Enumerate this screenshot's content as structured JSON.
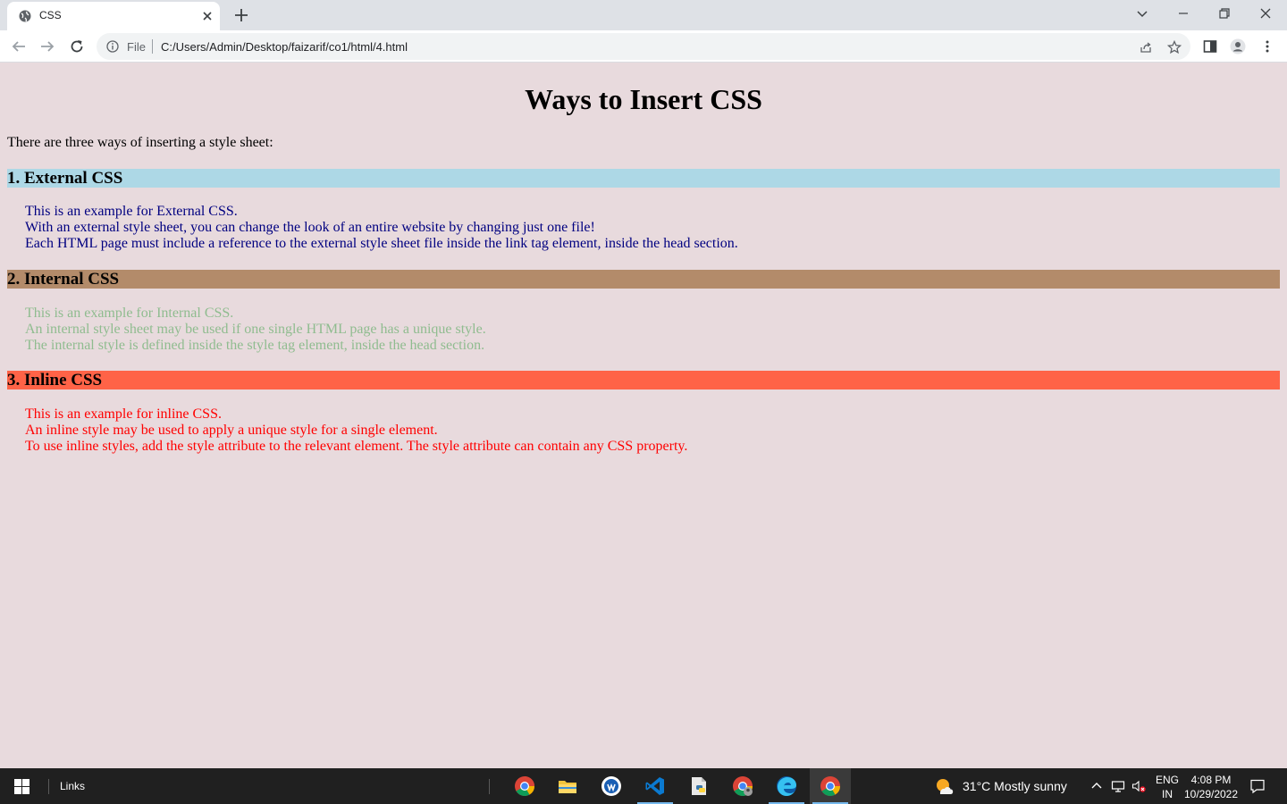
{
  "browser": {
    "tab_title": "CSS",
    "url_scheme": "File",
    "url": "C:/Users/Admin/Desktop/faizarif/co1/html/4.html"
  },
  "page": {
    "heading": "Ways to Insert CSS",
    "intro": "There are three ways of inserting a style sheet:",
    "sections": [
      {
        "title": "1. External CSS",
        "header_bg": "#add8e6",
        "text_color": "#000080",
        "lines": [
          "This is an example for External CSS.",
          "With an external style sheet, you can change the look of an entire website by changing just one file!",
          "Each HTML page must include a reference to the external style sheet file inside the link tag element, inside the head section."
        ]
      },
      {
        "title": "2. Internal CSS",
        "header_bg": "#b38b6a",
        "text_color": "#8fbc8f",
        "lines": [
          "This is an example for Internal CSS.",
          "An internal style sheet may be used if one single HTML page has a unique style.",
          "The internal style is defined inside the style tag element, inside the head section."
        ]
      },
      {
        "title": "3. Inline CSS",
        "header_bg": "#ff6347",
        "text_color": "#ff0000",
        "lines": [
          "This is an example for inline CSS.",
          "An inline style may be used to apply a unique style for a single element.",
          "To use inline styles, add the style attribute to the relevant element. The style attribute can contain any CSS property."
        ]
      }
    ]
  },
  "taskbar": {
    "links_label": "Links",
    "weather": "31°C  Mostly sunny",
    "lang_line1": "ENG",
    "lang_line2": "IN",
    "time": "4:08 PM",
    "date": "10/29/2022"
  }
}
